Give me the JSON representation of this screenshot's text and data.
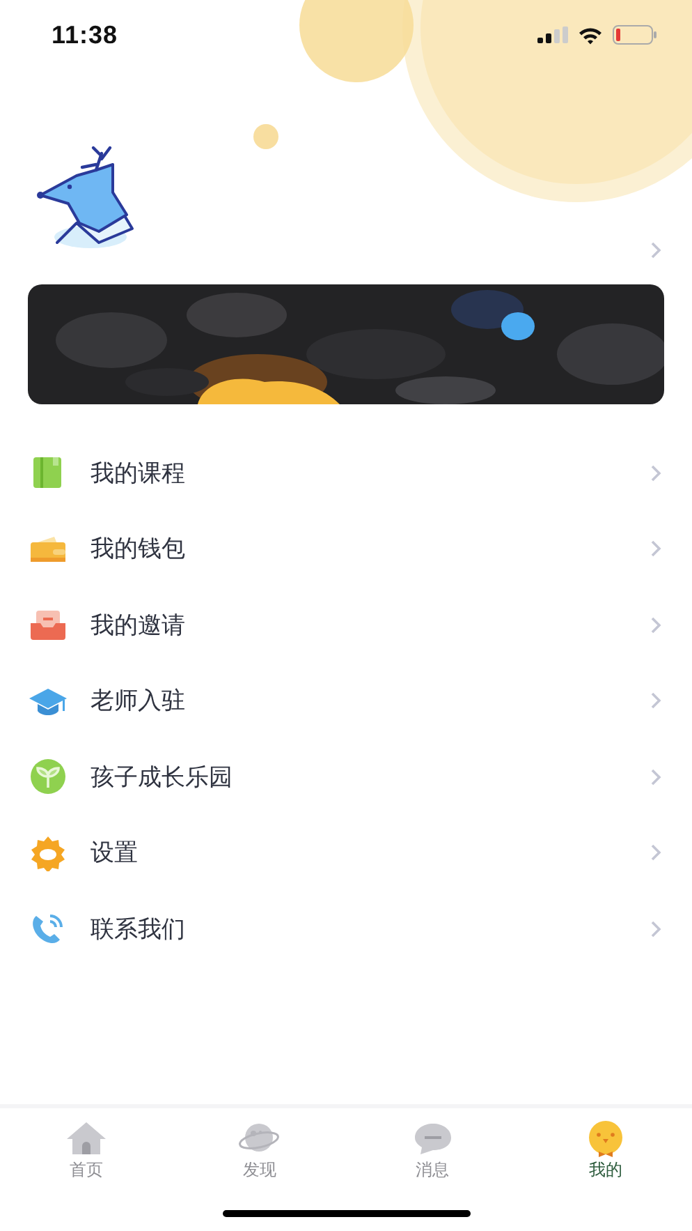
{
  "status_bar": {
    "time": "11:38"
  },
  "menu": [
    {
      "kind": "book",
      "label": "我的课程"
    },
    {
      "kind": "wallet",
      "label": "我的钱包"
    },
    {
      "kind": "invite",
      "label": "我的邀请"
    },
    {
      "kind": "cap",
      "label": "老师入驻"
    },
    {
      "kind": "sprout",
      "label": "孩子成长乐园"
    },
    {
      "kind": "gear",
      "label": "设置"
    },
    {
      "kind": "phone",
      "label": "联系我们"
    }
  ],
  "tab_bar": [
    {
      "kind": "home",
      "label": "首页",
      "selected": false
    },
    {
      "kind": "planet",
      "label": "发现",
      "selected": false
    },
    {
      "kind": "chat",
      "label": "消息",
      "selected": false
    },
    {
      "kind": "chick",
      "label": "我的",
      "selected": true
    }
  ]
}
